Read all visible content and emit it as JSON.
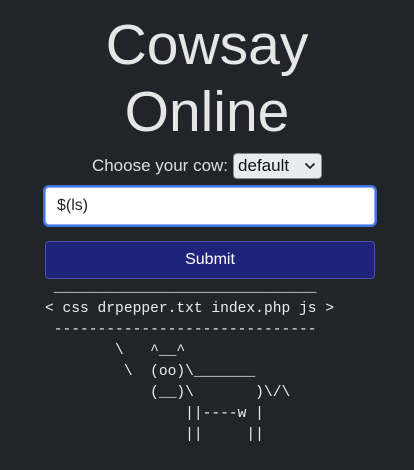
{
  "header": {
    "title_line1": "Cowsay",
    "title_line2": "Online"
  },
  "cow_selector": {
    "label": "Choose your cow:",
    "selected": "default"
  },
  "command_input": {
    "value": "$(ls)"
  },
  "submit": {
    "label": "Submit"
  },
  "output": {
    "text": " ______________________________\n< css drpepper.txt index.php js >\n ------------------------------\n        \\   ^__^\n         \\  (oo)\\_______\n            (__)\\       )\\/\\\n                ||----w |\n                ||     ||"
  }
}
